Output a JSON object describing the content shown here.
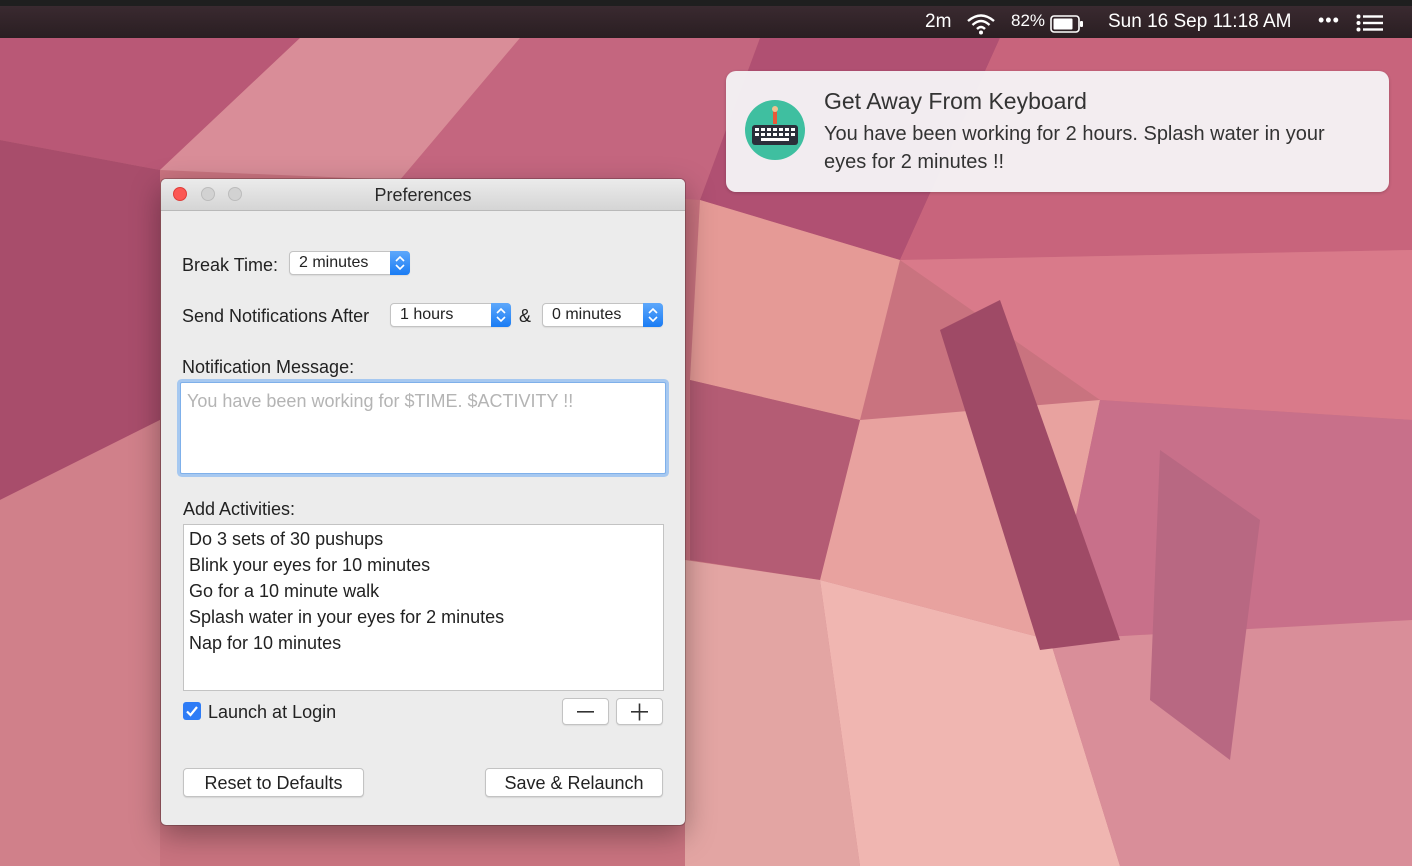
{
  "menubar": {
    "timer": "2m",
    "battery_percent": "82%",
    "clock": "Sun 16 Sep  11:18 AM",
    "icons": [
      "wifi-icon",
      "battery-icon",
      "more-dots-icon",
      "notification-center-icon"
    ]
  },
  "notification": {
    "title": "Get Away From Keyboard",
    "body": "You have been working for 2 hours. Splash water in your eyes for 2 minutes !!",
    "icon": "keyboard-app-icon"
  },
  "window": {
    "title": "Preferences",
    "break_time_label": "Break Time:",
    "break_time_value": "2 minutes",
    "send_after_label": "Send Notifications After",
    "hours_value": "1 hours",
    "ampersand": "&",
    "minutes_value": "0 minutes",
    "message_label": "Notification Message:",
    "message_placeholder": "You have been working for $TIME. $ACTIVITY !!",
    "activities_label": "Add Activities:",
    "activities": [
      "Do 3 sets of 30 pushups",
      "Blink your eyes for 10 minutes",
      "Go for a 10 minute walk",
      "Splash water in your eyes for 2 minutes",
      "Nap for 10 minutes"
    ],
    "launch_at_login_label": "Launch at Login",
    "launch_at_login_checked": true,
    "reset_label": "Reset to Defaults",
    "save_label": "Save & Relaunch"
  },
  "colors": {
    "accent": "#1a7cf4",
    "close": "#fc5753",
    "wallpaper_base": "#c9737f"
  }
}
